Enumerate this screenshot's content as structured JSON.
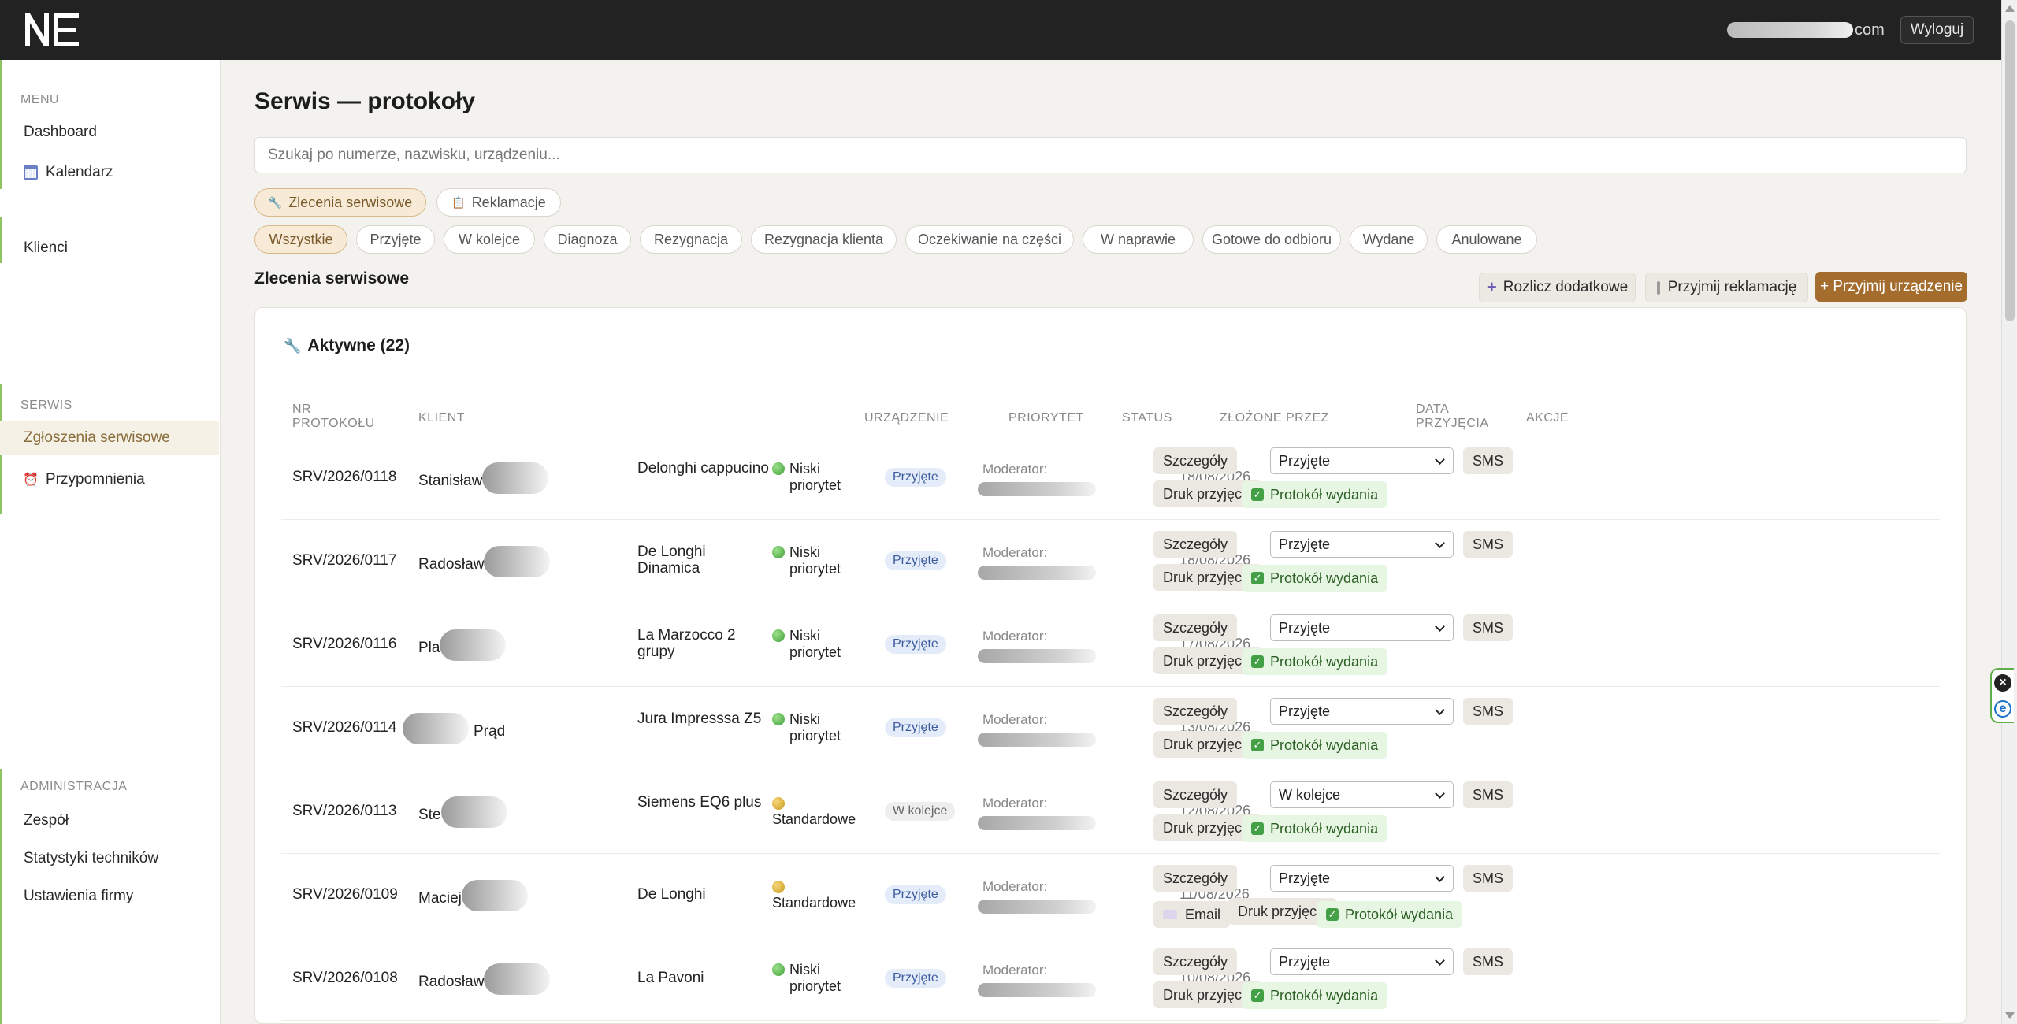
{
  "topbar": {
    "logo": "NE",
    "user_email_suffix": "com",
    "logout_label": "Wyloguj"
  },
  "sidebar": {
    "menu_heading": "MENU",
    "menu_items": [
      {
        "label": "Dashboard",
        "icon": ""
      },
      {
        "label": "Kalendarz",
        "icon": "calendar-icon"
      }
    ],
    "clients_label": "Klienci",
    "serwis_heading": "SERWIS",
    "serwis_items": [
      {
        "label": "Zgłoszenia serwisowe",
        "active": true
      },
      {
        "label": "Przypomnienia",
        "icon": "alarm-clock-icon"
      }
    ],
    "admin_heading": "ADMINISTRACJA",
    "admin_items": [
      {
        "label": "Zespół"
      },
      {
        "label": "Statystyki techników"
      },
      {
        "label": "Ustawienia firmy"
      }
    ]
  },
  "main": {
    "title": "Serwis — protokoły",
    "search_placeholder": "Szukaj po numerze, nazwisku, urządzeniu...",
    "type_tabs": [
      {
        "label": "Zlecenia serwisowe",
        "active": true,
        "icon": "wrench-icon"
      },
      {
        "label": "Reklamacje",
        "active": false,
        "icon": "clipboard-icon"
      }
    ],
    "status_filters": [
      "Wszystkie",
      "Przyjęte",
      "W kolejce",
      "Diagnoza",
      "Rezygnacja",
      "Rezygnacja klienta",
      "Oczekiwanie na części",
      "W naprawie",
      "Gotowe do odbioru",
      "Wydane",
      "Anulowane"
    ],
    "section_title": "Zlecenia serwisowe",
    "actions": {
      "extra": "Rozlicz dodatkowe",
      "complaint": "Przyjmij reklamację",
      "device": "+ Przyjmij urządzenie"
    },
    "card_title": "Aktywne (22)",
    "columns": {
      "nr": "NR PROTOKOŁU",
      "client": "KLIENT",
      "device": "URZĄDZENIE",
      "priority": "PRIORYTET",
      "status": "STATUS",
      "created_by": "ZŁOŻONE PRZEZ",
      "date": "DATA PRZYJĘCIA",
      "actions": "AKCJE"
    },
    "row_buttons": {
      "details": "Szczegóły",
      "sms": "SMS",
      "print": "Druk przyjęcia",
      "release": "Protokół wydania",
      "email": "Email"
    },
    "rows": [
      {
        "nr": "SRV/2026/0118",
        "client": "Stanisław",
        "device": "Delonghi cappucino",
        "priority": "Niski priorytet",
        "priority_color": "green",
        "status": "Przyjęte",
        "moderator": "Moderator:",
        "date": "18/08/2026",
        "select": "Przyjęte"
      },
      {
        "nr": "SRV/2026/0117",
        "client": "Radosław",
        "device": "De Longhi Dinamica",
        "priority": "Niski priorytet",
        "priority_color": "green",
        "status": "Przyjęte",
        "moderator": "Moderator:",
        "date": "18/08/2026",
        "select": "Przyjęte"
      },
      {
        "nr": "SRV/2026/0116",
        "client": "Pla",
        "device": "La Marzocco 2 grupy",
        "priority": "Niski priorytet",
        "priority_color": "green",
        "status": "Przyjęte",
        "moderator": "Moderator:",
        "date": "17/08/2026",
        "select": "Przyjęte"
      },
      {
        "nr": "SRV/2026/0114",
        "client": "Prąd",
        "device": "Jura Impresssa Z5",
        "priority": "Niski priorytet",
        "priority_color": "green",
        "status": "Przyjęte",
        "moderator": "Moderator:",
        "date": "13/08/2026",
        "select": "Przyjęte"
      },
      {
        "nr": "SRV/2026/0113",
        "client": "Ste",
        "device": "Siemens EQ6 plus",
        "priority": "Standardowe",
        "priority_color": "yellow",
        "status": "W kolejce",
        "moderator": "Moderator:",
        "date": "12/08/2026",
        "select": "W kolejce"
      },
      {
        "nr": "SRV/2026/0109",
        "client": "Maciej",
        "device": "De Longhi",
        "priority": "Standardowe",
        "priority_color": "yellow",
        "status": "Przyjęte",
        "moderator": "Moderator:",
        "date": "11/08/2026",
        "select": "Przyjęte",
        "has_email": true
      },
      {
        "nr": "SRV/2026/0108",
        "client": "Radosław",
        "device": "La Pavoni",
        "priority": "Niski priorytet",
        "priority_color": "green",
        "status": "Przyjęte",
        "moderator": "Moderator:",
        "date": "10/08/2026",
        "select": "Przyjęte"
      }
    ]
  }
}
